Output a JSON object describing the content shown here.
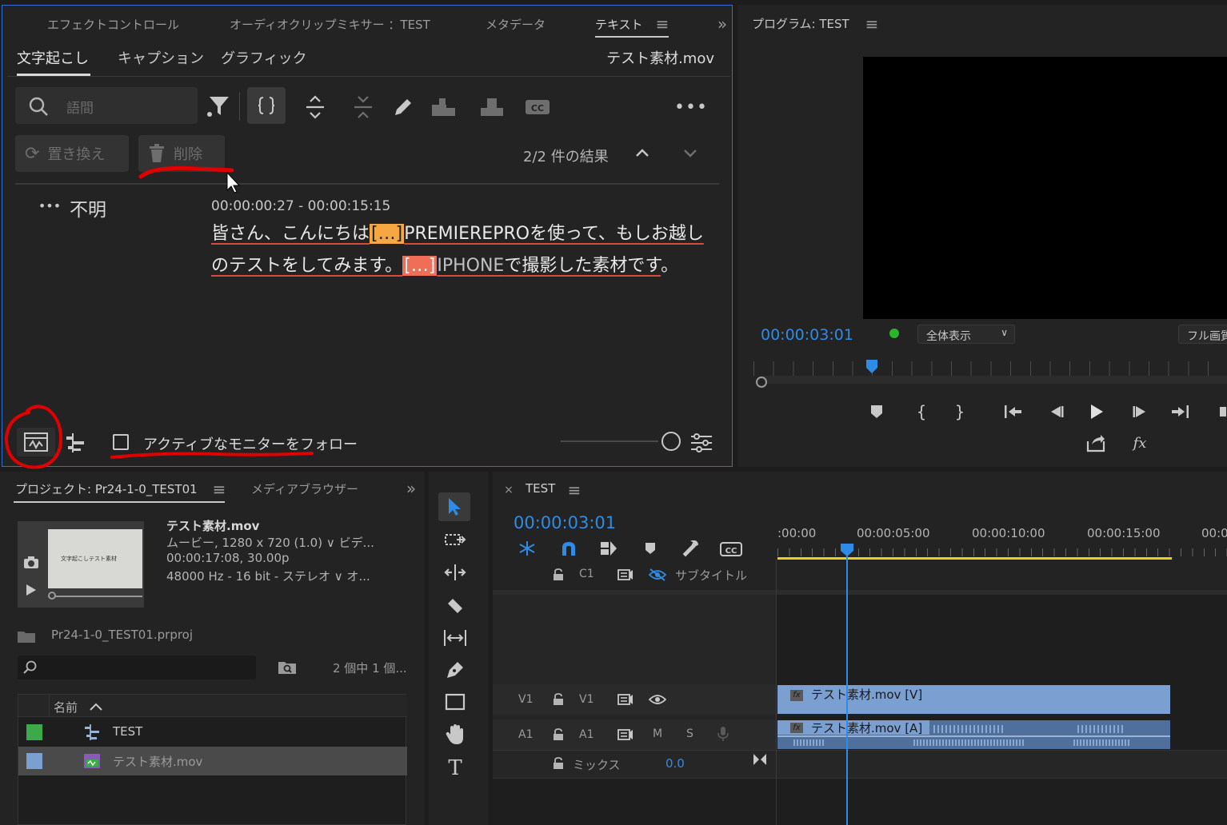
{
  "text_panel": {
    "tabs": [
      "エフェクトコントロール",
      "オーディオクリップミキサー ：TEST",
      "メタデータ",
      "テキスト"
    ],
    "subtabs": [
      "文字起こし",
      "キャプション",
      "グラフィック"
    ],
    "clip_name": "テスト素材.mov",
    "search_placeholder": "語間",
    "replace_label": "置き換え",
    "delete_label": "削除",
    "results": "2/2 件の結果",
    "speaker": "不明",
    "timecode": "00:00:00:27 - 00:00:15:15",
    "line1_a": "皆さん、こんにちは",
    "ellipsis": "[…]",
    "line1_b": "PREMIEREPROを使って、もしお越し",
    "line2_a": "のテストをしてみます。",
    "line2_b": "IPHONE",
    "line2_c": "で撮影した素材です",
    "line2_d": "。",
    "follow_monitor": "アクティブなモニターをフォロー"
  },
  "program": {
    "title": "プログラム: TEST",
    "timecode": "00:00:03:01",
    "zoom": "全体表示",
    "quality": "フル画質"
  },
  "project": {
    "tab1": "プロジェクト: Pr24-1-0_TEST01",
    "tab2": "メディアブラウザー",
    "media_name": "テスト素材.mov",
    "media_line1": "ムービー, 1280 x 720 (1.0) ∨ ビデ...",
    "media_line2": "00:00:17:08, 30.00p",
    "media_line3": "48000 Hz - 16 bit - ステレオ ∨ オ...",
    "thumb_text": "文字起こしテスト素材",
    "project_file": "Pr24-1-0_TEST01.prproj",
    "item_count": "2 個中 1 個...",
    "column_name": "名前",
    "items": [
      {
        "name": "TEST",
        "color": "#3daa4a"
      },
      {
        "name": "テスト素材.mov",
        "color": "#7b9fd0"
      }
    ]
  },
  "timeline": {
    "title": "TEST",
    "timecode": "00:00:03:01",
    "ruler": [
      ":00:00",
      "00:00:05:00",
      "00:00:10:00",
      "00:00:15:00",
      "00:0"
    ],
    "c1": "C1",
    "subtitle": "サブタイトル",
    "v1": "V1",
    "a1": "A1",
    "m": "M",
    "s": "S",
    "mix": "ミックス",
    "mix_value": "0.0",
    "clip_v": "テスト素材.mov [V]",
    "clip_a": "テスト素材.mov [A]",
    "fx": "fx"
  },
  "colors": {
    "accent_blue": "#2e8ce6",
    "annotation_red": "#e00000",
    "clip_video": "#7b9fd0",
    "clip_audio": "#4f6f9c",
    "work_area": "#e6d21a"
  }
}
